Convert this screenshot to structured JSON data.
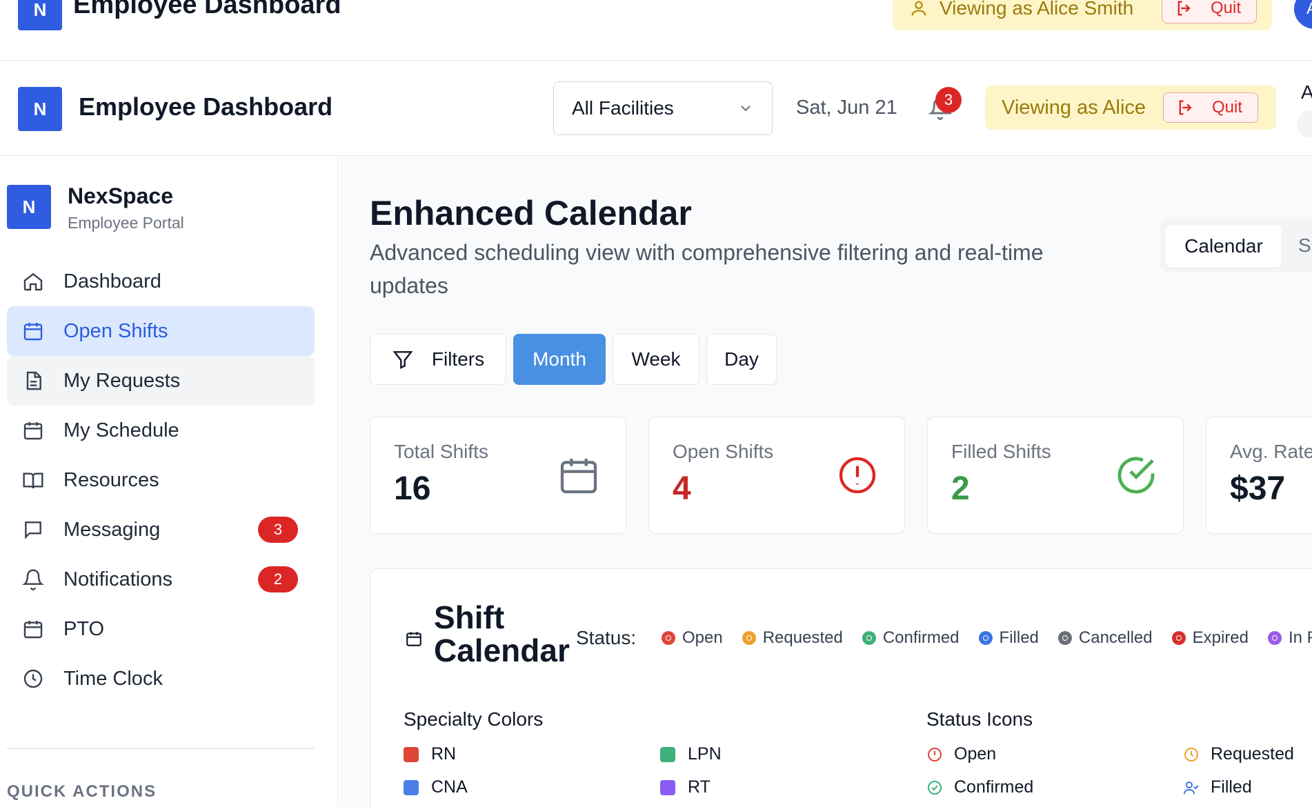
{
  "ghost_header": {
    "logo_letter": "N",
    "title": "Employee Dashboard",
    "viewing_label": "Viewing as Alice Smith",
    "quit_label": "Quit",
    "avatar_letter": "A"
  },
  "header": {
    "logo_letter": "N",
    "title": "Employee Dashboard",
    "facility_select": "All Facilities",
    "date": "Sat, Jun 21",
    "notification_count": "3",
    "viewing_label": "Viewing as Alice",
    "quit_label": "Quit",
    "right_letter": "A"
  },
  "sidebar": {
    "logo_letter": "N",
    "brand": "NexSpace",
    "subtitle": "Employee Portal",
    "items": [
      {
        "label": "Dashboard",
        "icon": "home-icon",
        "state": "normal",
        "badge": ""
      },
      {
        "label": "Open Shifts",
        "icon": "calendar-icon",
        "state": "active",
        "badge": ""
      },
      {
        "label": "My Requests",
        "icon": "file-icon",
        "state": "hover",
        "badge": ""
      },
      {
        "label": "My Schedule",
        "icon": "calendar-icon",
        "state": "normal",
        "badge": ""
      },
      {
        "label": "Resources",
        "icon": "book-icon",
        "state": "normal",
        "badge": ""
      },
      {
        "label": "Messaging",
        "icon": "message-icon",
        "state": "normal",
        "badge": "3"
      },
      {
        "label": "Notifications",
        "icon": "bell-icon",
        "state": "normal",
        "badge": "2"
      },
      {
        "label": "PTO",
        "icon": "calendar-icon",
        "state": "normal",
        "badge": ""
      },
      {
        "label": "Time Clock",
        "icon": "clock-icon",
        "state": "normal",
        "badge": ""
      }
    ],
    "quick_actions": "QUICK ACTIONS"
  },
  "main": {
    "title": "Enhanced Calendar",
    "subtitle": "Advanced scheduling view with comprehensive filtering and real-time updates",
    "view_toggle": {
      "active": "Calendar",
      "other": "Sl"
    },
    "buttons": {
      "filters": "Filters",
      "month": "Month",
      "week": "Week",
      "day": "Day"
    },
    "stats": [
      {
        "label": "Total Shifts",
        "value": "16",
        "color": "#111827",
        "icon": "calendar-icon",
        "icon_color": "#6b7280"
      },
      {
        "label": "Open Shifts",
        "value": "4",
        "color": "#c62828",
        "icon": "alert-circle-icon",
        "icon_color": "#dc2626"
      },
      {
        "label": "Filled Shifts",
        "value": "2",
        "color": "#3a9a48",
        "icon": "check-circle-icon",
        "icon_color": "#4caf50"
      },
      {
        "label": "Avg. Rate",
        "value": "$37",
        "color": "#111827",
        "icon": "",
        "icon_color": ""
      }
    ],
    "calendar": {
      "title_line1": "Shift",
      "title_line2": "Calendar",
      "status_label": "Status:",
      "status_legend": [
        {
          "label": "Open",
          "color": "#e0453a"
        },
        {
          "label": "Requested",
          "color": "#f0a030"
        },
        {
          "label": "Confirmed",
          "color": "#3fb07a"
        },
        {
          "label": "Filled",
          "color": "#3b74e6"
        },
        {
          "label": "Cancelled",
          "color": "#6b6f78"
        },
        {
          "label": "Expired",
          "color": "#d32f2f"
        },
        {
          "label": "In P",
          "color": "#9b5de5"
        }
      ],
      "specialty_title": "Specialty Colors",
      "specialties": [
        {
          "label": "RN",
          "color": "#e0453a"
        },
        {
          "label": "LPN",
          "color": "#3fb07a"
        },
        {
          "label": "CNA",
          "color": "#4a7ee8"
        },
        {
          "label": "RT",
          "color": "#8b5cf6"
        }
      ],
      "status_icons_title": "Status Icons",
      "status_icons": [
        {
          "label": "Open",
          "icon": "alert-circle-icon",
          "color": "#e0453a"
        },
        {
          "label": "Requested",
          "icon": "clock-icon",
          "color": "#f0a030"
        },
        {
          "label": "Confirmed",
          "icon": "check-circle-icon",
          "color": "#3fb07a"
        },
        {
          "label": "Filled",
          "icon": "user-check-icon",
          "color": "#3b74e6"
        }
      ]
    }
  }
}
